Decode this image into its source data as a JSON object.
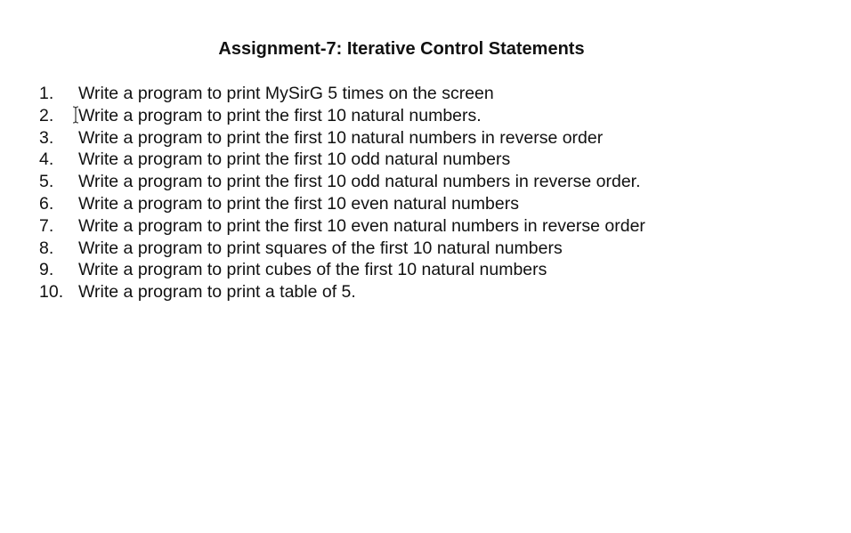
{
  "document": {
    "title": "Assignment-7: Iterative Control Statements",
    "items": [
      {
        "number": "1.",
        "text": "Write a program to print MySirG 5 times on the screen"
      },
      {
        "number": "2.",
        "text": "Write a program to print the first 10 natural numbers."
      },
      {
        "number": "3.",
        "text": "Write a program to print the first 10 natural numbers in reverse order"
      },
      {
        "number": "4.",
        "text": "Write a program to print the first 10 odd natural numbers"
      },
      {
        "number": "5.",
        "text": "Write a program to print the first 10 odd natural numbers in reverse order."
      },
      {
        "number": "6.",
        "text": "Write a program to print the first 10 even natural numbers"
      },
      {
        "number": "7.",
        "text": "Write a program to print the first 10 even natural numbers in reverse order"
      },
      {
        "number": "8.",
        "text": "Write a program to print squares of the first 10 natural numbers"
      },
      {
        "number": "9.",
        "text": "Write a program to print cubes of the first 10 natural numbers"
      },
      {
        "number": "10.",
        "text": "Write a program to print a table of 5."
      }
    ]
  },
  "colors": {
    "background": "#ffffff",
    "text": "#111111"
  },
  "icons": {
    "cursor": "text-cursor-icon"
  }
}
